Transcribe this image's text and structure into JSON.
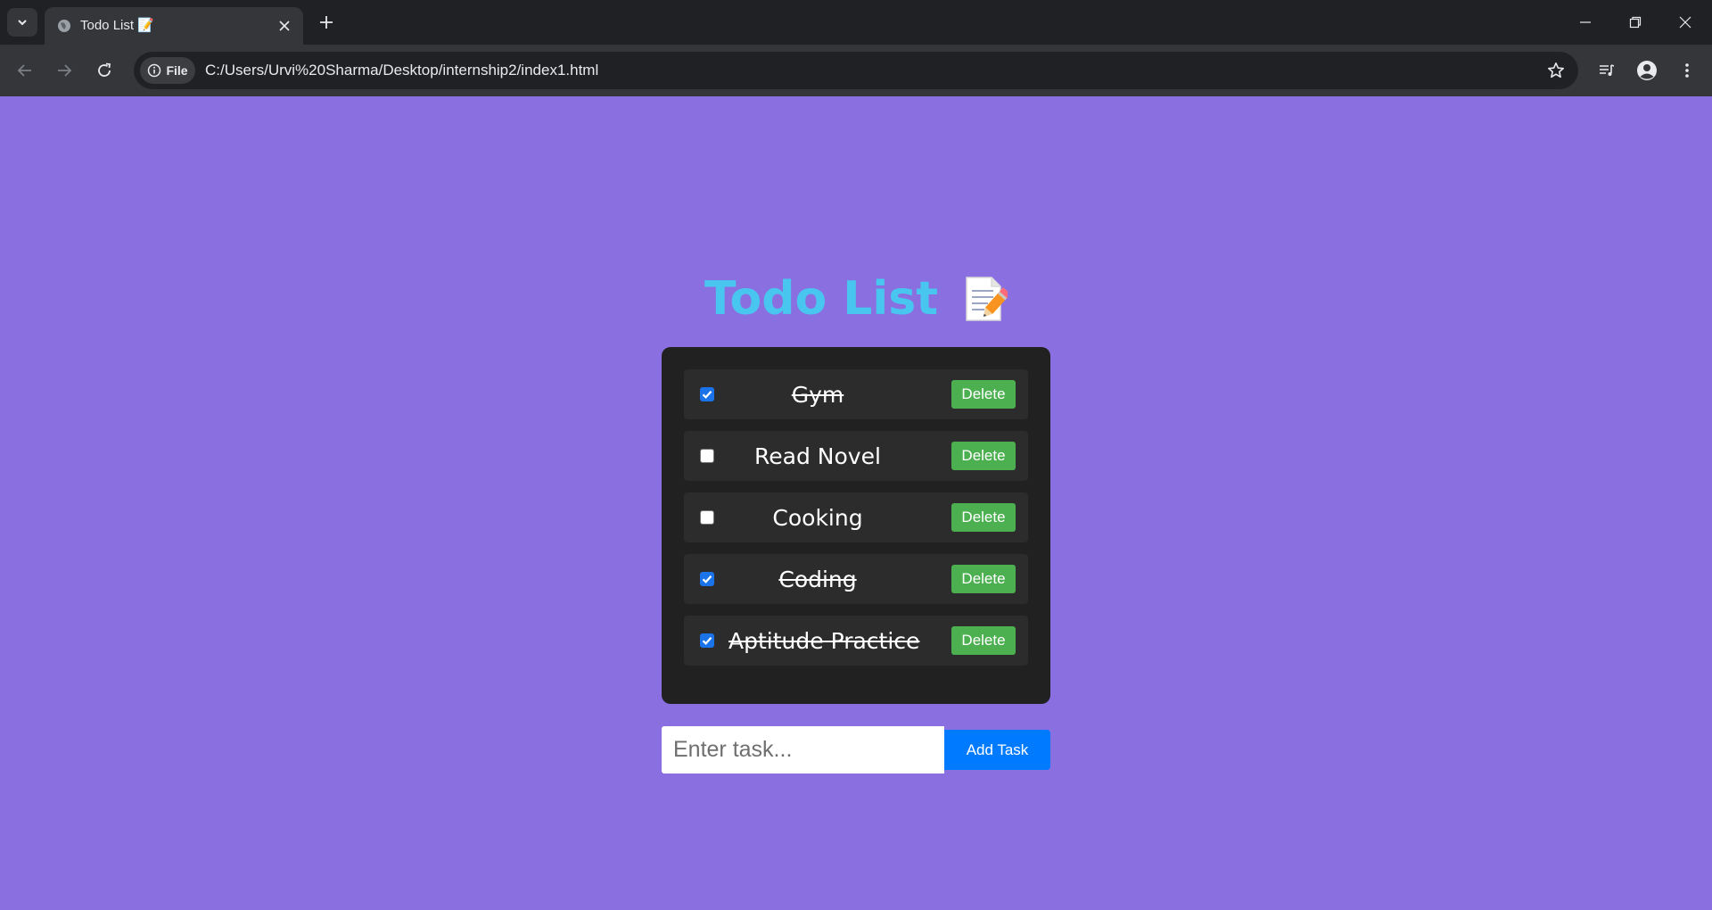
{
  "browser": {
    "tab_title": "Todo List 📝",
    "site_chip_label": "File",
    "url": "C:/Users/Urvi%20Sharma/Desktop/internship2/index1.html"
  },
  "app": {
    "title": "Todo List",
    "title_icon": "memo-icon",
    "accent_color": "#48c6ef",
    "background_color": "#8a6fe0",
    "todos": [
      {
        "label": "Gym",
        "done": true,
        "delete_label": "Delete"
      },
      {
        "label": "Read Novel",
        "done": false,
        "delete_label": "Delete"
      },
      {
        "label": "Cooking",
        "done": false,
        "delete_label": "Delete"
      },
      {
        "label": "Coding",
        "done": true,
        "delete_label": "Delete"
      },
      {
        "label": "Aptitude Practice",
        "done": true,
        "delete_label": "Delete"
      }
    ],
    "input_placeholder": "Enter task...",
    "input_value": "",
    "add_button_label": "Add Task",
    "delete_button_color": "#4caf50",
    "add_button_color": "#007bff"
  }
}
